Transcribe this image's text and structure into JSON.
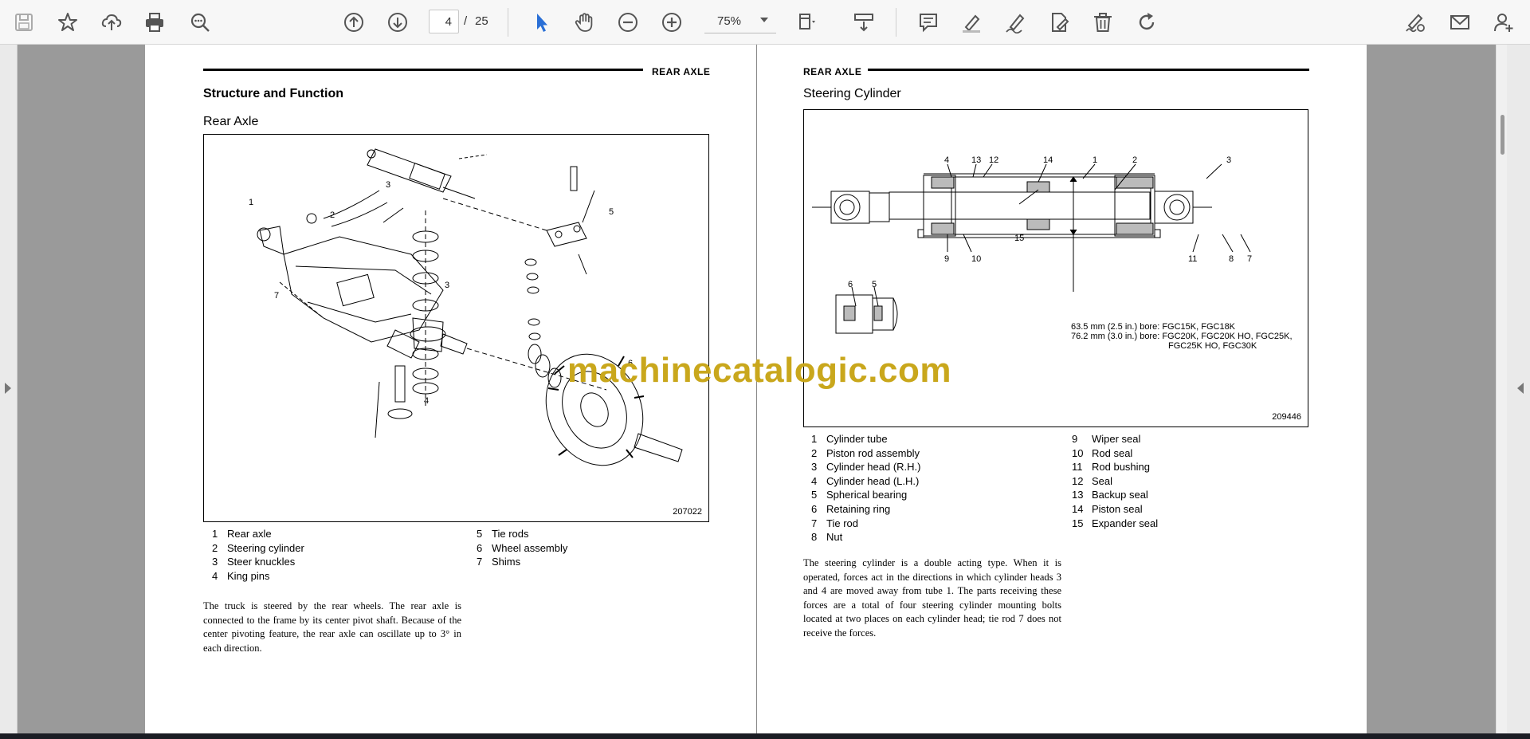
{
  "toolbar": {
    "current_page": "4",
    "page_separator": "/",
    "total_pages": "25",
    "zoom": "75%"
  },
  "left_page": {
    "header": "REAR AXLE",
    "section_title": "Structure and Function",
    "subtitle": "Rear Axle",
    "figure_number": "207022",
    "callouts": [
      "1",
      "2",
      "3",
      "3",
      "4",
      "5",
      "6",
      "7"
    ],
    "legend_left": [
      {
        "n": "1",
        "label": "Rear axle"
      },
      {
        "n": "2",
        "label": "Steering cylinder"
      },
      {
        "n": "3",
        "label": "Steer knuckles"
      },
      {
        "n": "4",
        "label": "King pins"
      }
    ],
    "legend_right": [
      {
        "n": "5",
        "label": "Tie rods"
      },
      {
        "n": "6",
        "label": "Wheel assembly"
      },
      {
        "n": "7",
        "label": "Shims"
      }
    ],
    "paragraph": "The truck is steered by the rear wheels.  The rear axle is connected to the frame by its center pivot shaft.  Because of the center pivoting feature, the rear axle can oscillate up to 3° in each direction."
  },
  "right_page": {
    "header": "REAR AXLE",
    "subtitle": "Steering Cylinder",
    "figure_number": "209446",
    "callouts_top": [
      "4",
      "13",
      "12",
      "14",
      "1",
      "2",
      "3"
    ],
    "callouts_bottom": [
      "9",
      "10",
      "11",
      "8",
      "7",
      "15"
    ],
    "callouts_detail": [
      "6",
      "5"
    ],
    "bore_line1": "63.5 mm (2.5 in.)  bore:  FGC15K, FGC18K",
    "bore_line2": "76.2 mm (3.0 in.)  bore:  FGC20K, FGC20K HO, FGC25K,",
    "bore_line3": "FGC25K HO, FGC30K",
    "legend_left": [
      {
        "n": "1",
        "label": "Cylinder tube"
      },
      {
        "n": "2",
        "label": "Piston rod assembly"
      },
      {
        "n": "3",
        "label": "Cylinder head (R.H.)"
      },
      {
        "n": "4",
        "label": "Cylinder head (L.H.)"
      },
      {
        "n": "5",
        "label": "Spherical bearing"
      },
      {
        "n": "6",
        "label": "Retaining ring"
      },
      {
        "n": "7",
        "label": "Tie rod"
      },
      {
        "n": "8",
        "label": "Nut"
      }
    ],
    "legend_right": [
      {
        "n": "9",
        "label": "Wiper seal"
      },
      {
        "n": "10",
        "label": "Rod seal"
      },
      {
        "n": "11",
        "label": "Rod bushing"
      },
      {
        "n": "12",
        "label": "Seal"
      },
      {
        "n": "13",
        "label": "Backup seal"
      },
      {
        "n": "14",
        "label": "Piston seal"
      },
      {
        "n": "15",
        "label": "Expander seal"
      }
    ],
    "paragraph": "The steering cylinder is a double acting type.  When it is operated, forces act in the directions in which cylinder heads 3 and 4 are moved away from tube 1.  The parts receiving these forces are a total of four steering cylinder mounting bolts located at two places on each cylinder head; tie rod 7 does not receive the forces."
  },
  "watermark": "machinecatalogic.com",
  "icons": [
    "save-icon",
    "star-icon",
    "upload-icon",
    "print-icon",
    "zoom-search-icon",
    "page-up-icon",
    "page-down-icon",
    "select-cursor-icon",
    "hand-icon",
    "zoom-out-icon",
    "zoom-in-icon",
    "fit-page-icon",
    "scroll-mode-icon",
    "comment-icon",
    "highlight-icon",
    "draw-icon",
    "edit-pdf-icon",
    "delete-icon",
    "rotate-icon",
    "sign-icon",
    "email-icon",
    "add-user-icon"
  ],
  "colors": {
    "accent": "#2a6fd6",
    "watermark": "#c9a71c",
    "toolbar": "#f7f7f7",
    "viewer_bg": "#9a9a9a"
  }
}
